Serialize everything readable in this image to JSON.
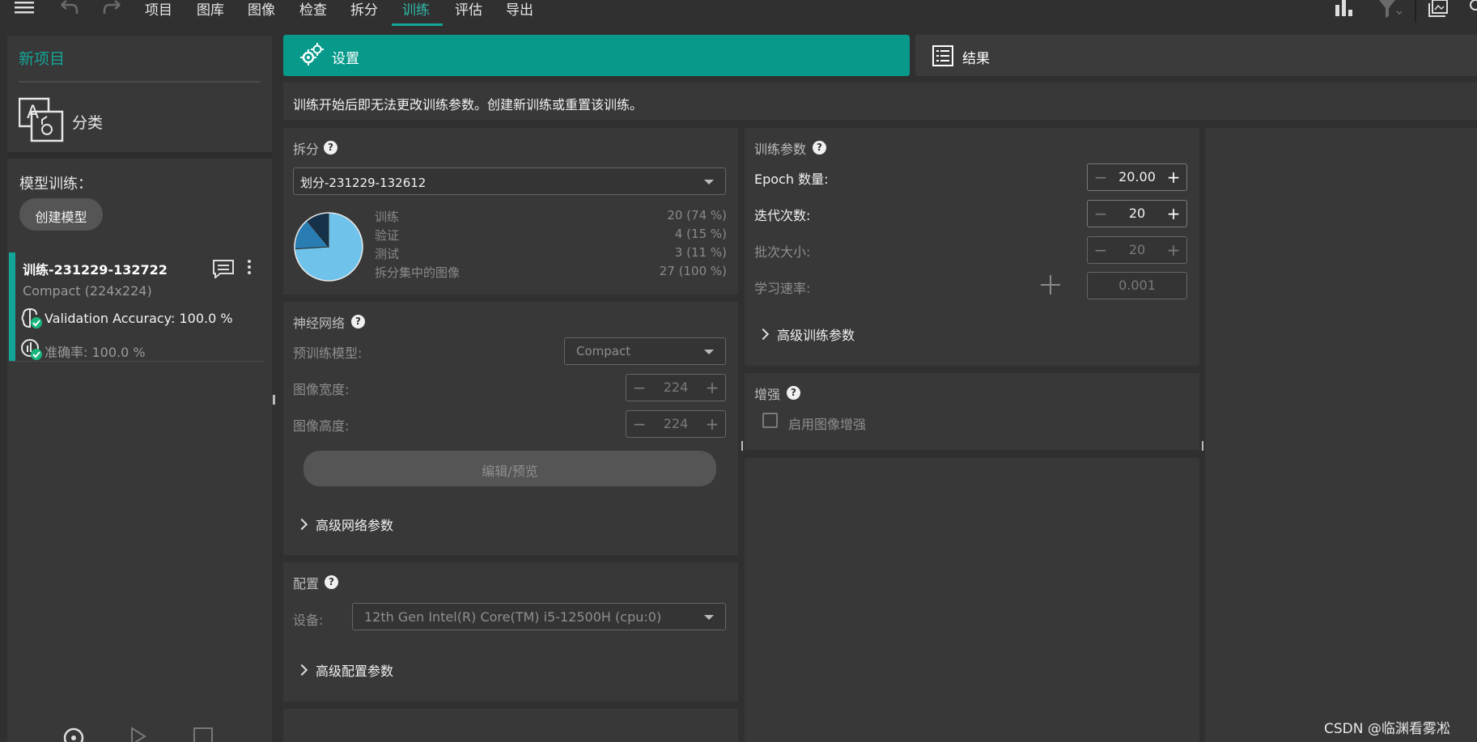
{
  "menu": {
    "items": [
      "项目",
      "图库",
      "图像",
      "检查",
      "拆分",
      "训练",
      "评估",
      "导出"
    ],
    "active": "训练"
  },
  "sidebar": {
    "project_title": "新项目",
    "project_type": "分类",
    "model_training_label": "模型训练：",
    "create_model_button": "创建模型",
    "training_run": {
      "name": "训练-231229-132722",
      "model": "Compact (224x224)",
      "validation_accuracy": "Validation Accuracy: 100.0 %",
      "accuracy": "准确率: 100.0 %"
    }
  },
  "tabs": {
    "settings": "设置",
    "results": "结果"
  },
  "notice": "训练开始后即无法更改训练参数。创建新训练或重置该训练。",
  "split": {
    "title": "拆分",
    "selected": "划分-231229-132612",
    "rows": [
      {
        "label": "训练",
        "value": "20 (74 %)"
      },
      {
        "label": "验证",
        "value": "4 (15 %)"
      },
      {
        "label": "测试",
        "value": "3 (11 %)"
      },
      {
        "label": "拆分集中的图像",
        "value": "27 (100 %)"
      }
    ],
    "pie": [
      {
        "name": "训练",
        "fraction": 0.74,
        "color": "#6fc3ea"
      },
      {
        "name": "验证",
        "fraction": 0.15,
        "color": "#2a7db3"
      },
      {
        "name": "测试",
        "fraction": 0.11,
        "color": "#16324a"
      }
    ]
  },
  "network": {
    "title": "神经网络",
    "pretrained_label": "预训练模型:",
    "pretrained_value": "Compact",
    "width_label": "图像宽度:",
    "width_value": "224",
    "height_label": "图像高度:",
    "height_value": "224",
    "edit_button": "编辑/预览",
    "advanced": "高级网络参数"
  },
  "config": {
    "title": "配置",
    "device_label": "设备:",
    "device_value": "12th Gen Intel(R) Core(TM) i5-12500H (cpu:0)",
    "advanced": "高级配置参数"
  },
  "train_params": {
    "title": "训练参数",
    "epochs_label": "Epoch 数量:",
    "epochs_value": "20.00",
    "iterations_label": "迭代次数:",
    "iterations_value": "20",
    "batch_label": "批次大小:",
    "batch_value": "20",
    "lr_label": "学习速率:",
    "lr_value": "0.001",
    "advanced": "高级训练参数"
  },
  "augmentation": {
    "title": "增强",
    "enable_label": "启用图像增强",
    "enabled": false
  },
  "watermark": "CSDN @临渊看雾凇",
  "colors": {
    "accent": "#13a597",
    "tab_active": "#079a8b",
    "background": "#303030",
    "panel": "#383838"
  }
}
